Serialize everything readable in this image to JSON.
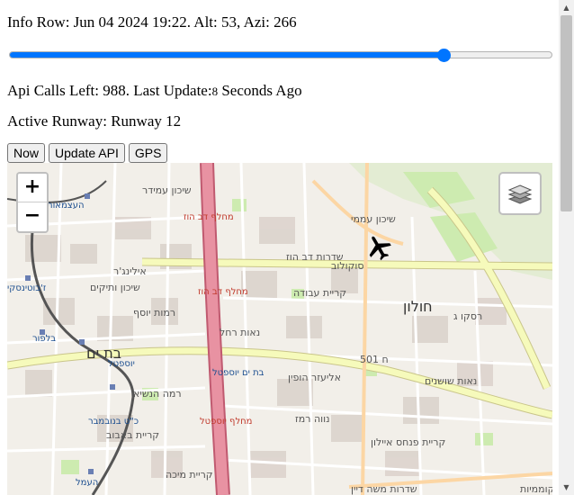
{
  "info_row": {
    "text": "Info Row: Jun 04 2024 19:22. Alt: 53, Azi: 266"
  },
  "time_slider": {
    "value_fraction": 0.8
  },
  "api_row": {
    "prefix": "Api Calls Left: 988. Last Update:",
    "seconds": "8",
    "suffix": " Seconds Ago"
  },
  "runway_row": {
    "text": "Active Runway: Runway 12"
  },
  "buttons": {
    "now": "Now",
    "update_api": "Update API",
    "gps": "GPS"
  },
  "map": {
    "zoom_in": "+",
    "zoom_out": "−",
    "layers_icon": "layers-icon",
    "plane_icon": "airplane-icon",
    "labels": [
      "שיכון עמידר",
      "העצמאות",
      "מחלף דב הוז",
      "שיכון עממי",
      "שדרות דב הוז",
      "סוקולוב",
      "אילינג'ר",
      "שיכון ותיקים",
      "ז'בוטינסקי",
      "רמות יוסף",
      "מחלף דב הוז",
      "קריית עבודה",
      "חולון",
      "בלפור",
      "בת ים",
      "יוספטל",
      "נאות רחל",
      "רסקו ג",
      "ח 501",
      "רמה הנשיא",
      "בת ים יוספטל",
      "אליעזר הופין",
      "נאות שושנים",
      "כ\"ט בנובמבר",
      "מחלף יוספטל",
      "נווה רמז",
      "קריית באבוב",
      "קריית פנחס איילון",
      "קריית מיכה",
      "העמל",
      "שדרות משה דיין",
      "קוממיות"
    ],
    "colors": {
      "land": "#f2efe9",
      "motorway": "#e892a2",
      "primary_road": "#f6fabb",
      "park": "#cdebb0",
      "building": "#d9d0c9",
      "rail": "#555555",
      "control_accent": "#0075ff"
    }
  }
}
